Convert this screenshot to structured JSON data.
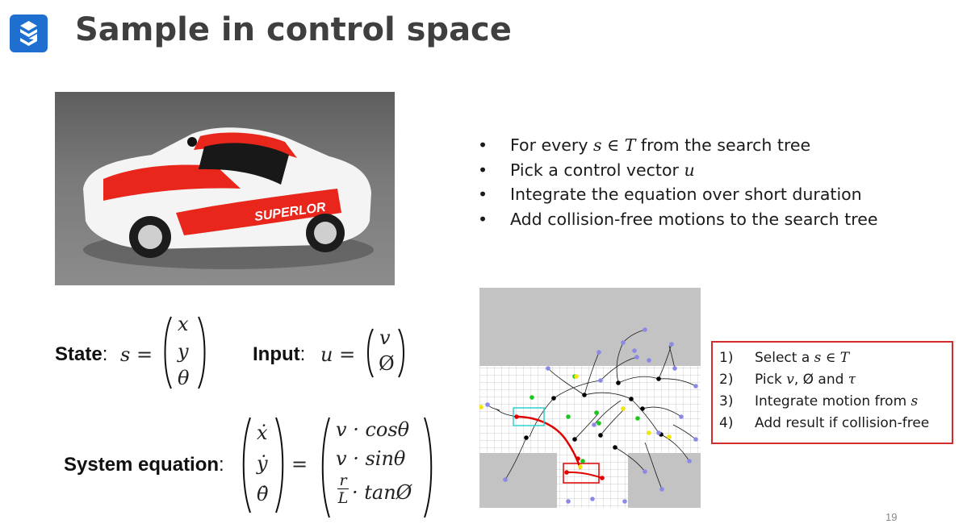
{
  "slide": {
    "title": "Sample in control space",
    "page_number": "19"
  },
  "bullets": [
    {
      "pre": "For every ",
      "math": "s ∈ T",
      "post": " from the search tree"
    },
    {
      "pre": "Pick a control vector ",
      "math": "u",
      "post": ""
    },
    {
      "pre": "Integrate the equation over short duration",
      "math": "",
      "post": ""
    },
    {
      "pre": "Add collision-free motions to the search tree",
      "math": "",
      "post": ""
    }
  ],
  "equations": {
    "state_label": "State",
    "state_lhs": "s =",
    "state_vector": [
      "x",
      "y",
      "θ"
    ],
    "input_label": "Input",
    "input_lhs": "u =",
    "input_vector": [
      "v",
      "Ø"
    ],
    "system_label": "System equation",
    "system_lhs": [
      "ẋ",
      "ẏ",
      "θ̇"
    ],
    "system_rhs": [
      "v · cosθ",
      "v · sinθ",
      "· tanØ"
    ],
    "fraction_num": "r",
    "fraction_den": "L"
  },
  "car_photo": {
    "decal": "SUPERLOR"
  },
  "steps": [
    {
      "num": "1)",
      "pre": "Select a ",
      "math": "s ∈ T",
      "post": ""
    },
    {
      "num": "2)",
      "pre": "Pick ",
      "math": "v",
      "post": ", Ø and ",
      "math2": "τ"
    },
    {
      "num": "3)",
      "pre": "Integrate motion from ",
      "math": "s",
      "post": ""
    },
    {
      "num": "4)",
      "pre": "Add result if collision-free",
      "math": "",
      "post": ""
    }
  ],
  "colors": {
    "accent": "#1f6fd1",
    "steps_border": "#d62b2b",
    "path": "#e00000",
    "highlight_box": "#31d0d0"
  }
}
